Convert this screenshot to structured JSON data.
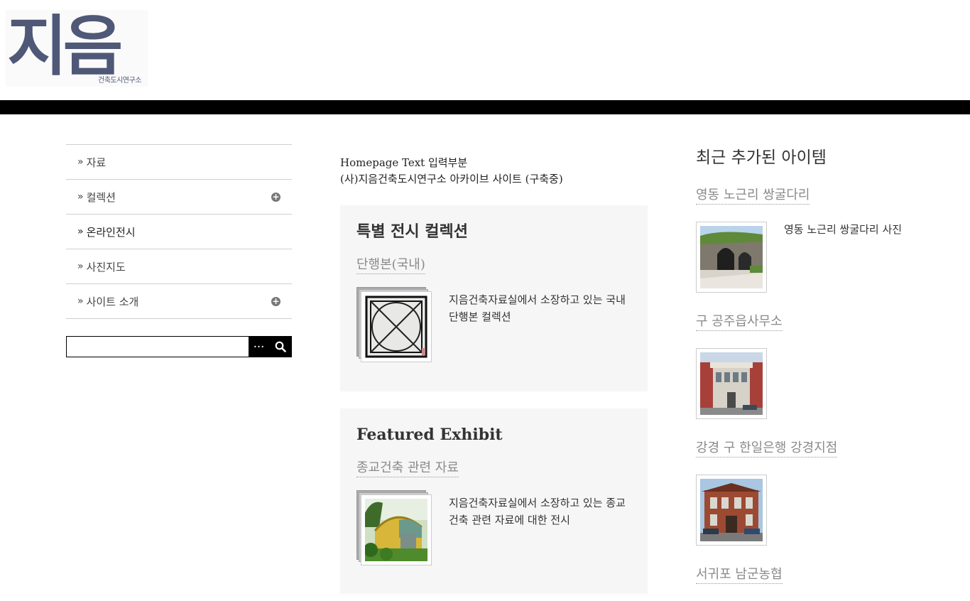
{
  "header": {
    "logo_main": "지음",
    "logo_sub": "건축도시연구소"
  },
  "nav": {
    "items": [
      {
        "label": "자료",
        "expandable": false
      },
      {
        "label": "컬렉션",
        "expandable": true
      },
      {
        "label": "온라인전시",
        "expandable": false
      },
      {
        "label": "사진지도",
        "expandable": false
      },
      {
        "label": "사이트 소개",
        "expandable": true
      }
    ],
    "bullet": "»",
    "expand_icon": "plus-circle-icon"
  },
  "search": {
    "value": "",
    "advanced_label": "···",
    "submit_icon": "search-icon"
  },
  "intro": {
    "line1": "Homepage Text 입력부분",
    "line2": "(사)지음건축도시연구소 아카이브 사이트 (구축중)"
  },
  "featured_collection": {
    "heading": "특별 전시 컬렉션",
    "title": "단행본(국내)",
    "description": "지음건축자료실에서 소장하고 있는 국내 단행본 컬렉션"
  },
  "featured_exhibit": {
    "heading": "Featured Exhibit",
    "title": "종교건축 관련 자료",
    "description": "지음건축자료실에서 소장하고 있는 종교건축 관련 자료에 대한 전시"
  },
  "recent": {
    "heading": "최근 추가된 아이템",
    "items": [
      {
        "title": "영동 노근리 쌍굴다리",
        "description": "영동 노근리 쌍굴다리 사진"
      },
      {
        "title": "구 공주읍사무소",
        "description": ""
      },
      {
        "title": "강경 구 한일은행 강경지점",
        "description": ""
      },
      {
        "title": "서귀포 남군농협",
        "description": ""
      }
    ]
  },
  "colors": {
    "logo": "#4f5876",
    "bar": "#000000",
    "panel_bg": "#f6f6f6",
    "link_gray": "#8a8a8a"
  }
}
